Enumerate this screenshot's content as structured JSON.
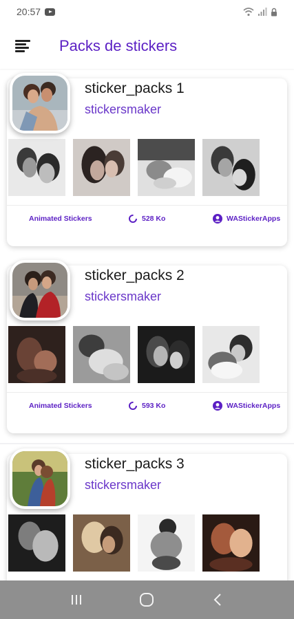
{
  "status_bar": {
    "time": "20:57"
  },
  "app_bar": {
    "title": "Packs de stickers"
  },
  "packs": [
    {
      "name": "sticker_packs 1",
      "author": "stickersmaker",
      "type_label": "Animated Stickers",
      "size": "528 Ko",
      "publisher": "WAStickerApps"
    },
    {
      "name": "sticker_packs 2",
      "author": "stickersmaker",
      "type_label": "Animated Stickers",
      "size": "593 Ko",
      "publisher": "WAStickerApps"
    },
    {
      "name": "sticker_packs 3",
      "author": "stickersmaker"
    }
  ],
  "colors": {
    "accent": "#5b1fc4",
    "author": "#6a37c9",
    "nav_bar": "#8f8f8f"
  },
  "icons": [
    "menu-icon",
    "youtube-icon",
    "wifi-icon",
    "signal-icon",
    "lock-icon",
    "loader-icon",
    "user-circle-icon",
    "recent-apps-icon",
    "home-icon",
    "back-icon"
  ]
}
